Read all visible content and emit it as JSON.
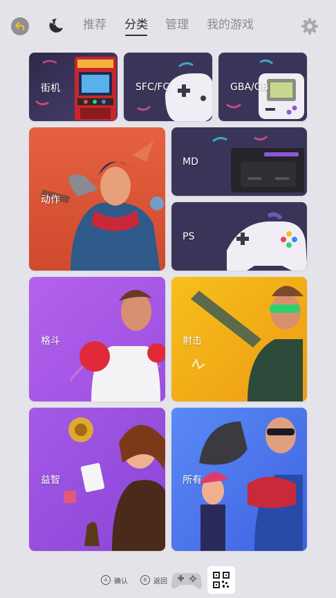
{
  "nav": {
    "tabs": [
      "推荐",
      "分类",
      "管理",
      "我的游戏"
    ],
    "active_tab": "分类"
  },
  "categories": {
    "arcade": "街机",
    "sfc_fc": "SFC/FC",
    "gba_gb": "GBA/GB",
    "action": "动作",
    "md": "MD",
    "ps": "PS",
    "fighting": "格斗",
    "shooting": "射击",
    "puzzle": "益智",
    "all": "所有"
  },
  "footer": {
    "confirm_key": "A",
    "confirm_label": "确认",
    "back_key": "B",
    "back_label": "返回"
  },
  "colors": {
    "background": "#e4e3ea",
    "tab_active": "#2d2d35",
    "tab_inactive": "#8b8b93",
    "console_card": "#3a3558",
    "action_card": "#e5613f",
    "fighting_card": "#a55de6",
    "shooting_card": "#f2b51a",
    "puzzle_card": "#9b4fe0",
    "all_card": "#4a74f0"
  },
  "icons": [
    "back-arrow-icon",
    "night-mode-icon",
    "settings-gear-icon",
    "gamepad-icon",
    "qr-code-icon"
  ]
}
